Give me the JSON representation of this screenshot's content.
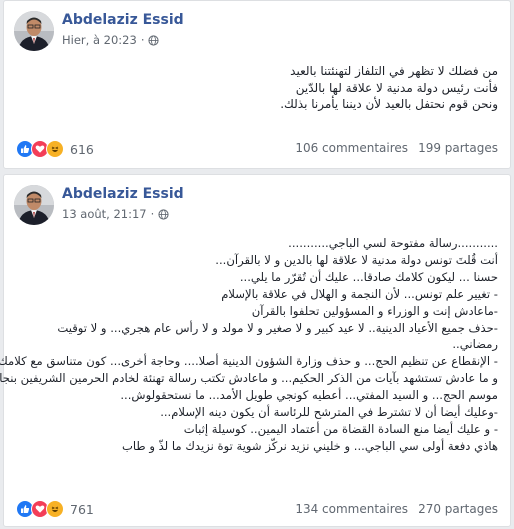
{
  "posts": [
    {
      "author": "Abdelaziz Essid",
      "timestamp": "Hier, à 20:23",
      "privacy_icon": "globe-icon",
      "lines": [
        "من فضلك لا تظهر في التلفاز لتهنئتنا بالعيد",
        "فأنت رئيس دولة مدنية لا علاقة لها بالدّين",
        "ونحن قوم نحتفل بالعيد لأن ديننا يأمرنا بذلك."
      ],
      "reaction_icons": [
        "like-icon",
        "love-icon",
        "haha-icon"
      ],
      "reaction_count": "616",
      "comments": "106 commentaires",
      "shares": "199 partages"
    },
    {
      "author": "Abdelaziz Essid",
      "timestamp": "13 août, 21:17",
      "privacy_icon": "globe-icon",
      "lines": [
        "...........رسالة مفتوحة لسي الباجي...........",
        "أنت قُلتَ تونس دولة مدنية لا علاقة لها بالدين و لا بالقرآن...",
        "حسنا ... ليكون كلامك صادقا... عليك أن تُقرّر ما يلي...",
        "- تغيير علم تونس... لأن النجمة و الهلال في علاقة بالإسلام",
        "-ماعادش إنت و الوزراء و المسؤولين تحلفوا بالقرآن",
        "-حذف جميع الأعياد الدينية.. لا عيد كبير و لا صغير و لا مولد و لا رأس عام هجري... و لا توقيت",
        "رمضاني..",
        "- الإنقطاع عن تنظيم الحج... و حذف وزارة الشؤون الدينية أصلا.... وحاجة أخرى... كون متناسق مع كلامك..",
        "و ما عادش تستشهد بآيات من الذكر الحكيم... و ماعادش تكتب رسالة تهنئة لخادم الحرمين الشريفين بنجاح",
        "موسم الحج... و السيد المفتي... أعطيه كونجي طويل الأمد... ما نستحقولوش...",
        "-وعليك أيضا أن لا تشترط في المترشح للرئاسة أن يكون دينه الإسلام...",
        "- و عليك أيضا منع السادة القضاة من أعتماد اليمين.. كوسيلة إثبات",
        "هاذي دفعة أولى سي الباجي... و خليني نزيد نركّز شوية توة نزيدك ما لذّ و طاب"
      ],
      "reaction_icons": [
        "like-icon",
        "love-icon",
        "haha-icon"
      ],
      "reaction_count": "761",
      "comments": "134 commentaires",
      "shares": "270 partages"
    }
  ],
  "colors": {
    "author": "#385898",
    "like": "#2078f4",
    "love": "#f33e58",
    "haha": "#f7b125"
  }
}
